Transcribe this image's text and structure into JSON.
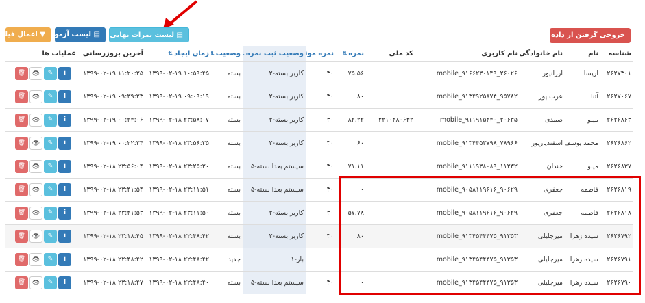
{
  "toolbar": {
    "export_label": "خروجی گرفتن از داده ها ▾",
    "final_scores_label": "▤ لیست نمرات نهایی افراد",
    "exams_label": "▤ لیست آزمون",
    "filter_label": "▼ اعمال فیلتر"
  },
  "columns": {
    "id": "شناسه",
    "first_name": "نام",
    "last_name": "نام خانوادگی",
    "username": "نام کاربری",
    "national_code": "کد ملی",
    "score": "نمره",
    "effective_score": "نمره موثر",
    "registration_status": "وضعیت ثبت نمره",
    "status": "وضعیت",
    "created": "زمان ایجاد",
    "updated": "آخرین بروزرسانی",
    "actions": "عملیات ها"
  },
  "rows": [
    {
      "id": "۲۶۲۷۳۰۱",
      "first_name": "اریسا",
      "last_name": "ارزانپور",
      "username": "mobile_۹۱۶۶۲۳۰۱۴۹_۲۶۰۲۶",
      "national_code": "",
      "score": "۷۵.۵۶",
      "effective_score": "۳۰",
      "registration_status": "کاربر بسته-۲",
      "status": "بسته",
      "created": "۱۳۹۹-۰۲-۱۹ ۱۰:۵۹:۴۵",
      "updated": "۱۳۹۹-۰۲-۱۹ ۱۱:۲۰:۲۵"
    },
    {
      "id": "۲۶۲۷۰۶۷",
      "first_name": "آتنا",
      "last_name": "عرب پور",
      "username": "mobile_۹۱۳۴۹۲۵۸۷۴_۹۵۷۸۲",
      "national_code": "",
      "score": "۸۰",
      "effective_score": "۳۰",
      "registration_status": "کاربر بسته-۲",
      "status": "بسته",
      "created": "۱۳۹۹-۰۲-۱۹ ۰۹:۰۹:۱۹",
      "updated": "۱۳۹۹-۰۲-۱۹ ۰۹:۳۹:۲۳"
    },
    {
      "id": "۲۶۲۶۸۶۳",
      "first_name": "مینو",
      "last_name": "صمدی",
      "username": "mobile_۹۱۱۹۱۵۴۴۰_۲۰۶۳۵",
      "national_code": "۲۲۱۰۴۸۰۶۴۲",
      "score": "۸۲.۲۲",
      "effective_score": "۳۰",
      "registration_status": "کاربر بسته-۲",
      "status": "بسته",
      "created": "۱۳۹۹-۰۲-۱۸ ۲۳:۵۸:۰۷",
      "updated": "۱۳۹۹-۰۲-۱۹ ۰۰:۲۴:۰۶"
    },
    {
      "id": "۲۶۲۶۸۶۲",
      "first_name": "محمد یوسف",
      "last_name": "اسفندیارپور",
      "username": "mobile_۹۱۳۴۴۵۳۷۹۸_۷۸۹۶۶",
      "national_code": "",
      "score": "۶۰",
      "effective_score": "۳۰",
      "registration_status": "کاربر بسته-۲",
      "status": "بسته",
      "created": "۱۳۹۹-۰۲-۱۸ ۲۳:۵۶:۳۵",
      "updated": "۱۳۹۹-۰۲-۱۹ ۰۰:۲۲:۲۴"
    },
    {
      "id": "۲۶۲۶۸۳۷",
      "first_name": "مینو",
      "last_name": "خندان",
      "username": "mobile_۹۱۱۱۹۳۸۰۸۹_۱۱۲۳۲",
      "national_code": "",
      "score": "۷۱.۱۱",
      "effective_score": "۳۰",
      "registration_status": "سیستم بعدا بسته-۵",
      "status": "بسته",
      "created": "۱۳۹۹-۰۲-۱۸ ۲۳:۲۵:۲۰",
      "updated": "۱۳۹۹-۰۲-۱۸ ۲۳:۵۶:۰۴"
    },
    {
      "id": "۲۶۲۶۸۱۹",
      "first_name": "فاطمه",
      "last_name": "جعفری",
      "username": "mobile_۹۰۵۸۱۱۹۶۱۶_۹۰۶۲۹",
      "national_code": "",
      "score": "۰",
      "effective_score": "۳۰",
      "registration_status": "سیستم بعدا بسته-۵",
      "status": "بسته",
      "created": "۱۳۹۹-۰۲-۱۸ ۲۳:۱۱:۵۱",
      "updated": "۱۳۹۹-۰۲-۱۸ ۲۳:۴۱:۵۴"
    },
    {
      "id": "۲۶۲۶۸۱۸",
      "first_name": "فاطمه",
      "last_name": "جعفری",
      "username": "mobile_۹۰۵۸۱۱۹۶۱۶_۹۰۶۲۹",
      "national_code": "",
      "score": "۵۷.۷۸",
      "effective_score": "۳۰",
      "registration_status": "کاربر بسته-۲",
      "status": "بسته",
      "created": "۱۳۹۹-۰۲-۱۸ ۲۳:۱۱:۵۰",
      "updated": "۱۳۹۹-۰۲-۱۸ ۲۳:۴۱:۵۳"
    },
    {
      "id": "۲۶۲۶۷۹۲",
      "first_name": "سیده زهرا",
      "last_name": "میرجلیلی",
      "username": "mobile_۹۱۳۴۵۴۴۴۷۵_۹۱۳۵۳",
      "national_code": "",
      "score": "۸۰",
      "effective_score": "۳۰",
      "registration_status": "کاربر بسته-۲",
      "status": "بسته",
      "created": "۱۳۹۹-۰۲-۱۸ ۲۲:۴۸:۴۲",
      "updated": "۱۳۹۹-۰۲-۱۸ ۲۳:۱۸:۴۵"
    },
    {
      "id": "۲۶۲۶۷۹۱",
      "first_name": "سیده زهرا",
      "last_name": "میرجلیلی",
      "username": "mobile_۹۱۳۴۵۴۴۴۷۵_۹۱۳۵۳",
      "national_code": "",
      "score": "",
      "effective_score": "",
      "registration_status": "باز-۱",
      "status": "جدید",
      "created": "۱۳۹۹-۰۲-۱۸ ۲۲:۴۸:۴۲",
      "updated": "۱۳۹۹-۰۲-۱۸ ۲۲:۴۸:۴۲"
    },
    {
      "id": "۲۶۲۶۷۹۰",
      "first_name": "سیده زهرا",
      "last_name": "میرجلیلی",
      "username": "mobile_۹۱۳۴۵۴۴۴۷۵_۹۱۳۵۳",
      "national_code": "",
      "score": "۰",
      "effective_score": "۳۰",
      "registration_status": "سیستم بعدا بسته-۵",
      "status": "بسته",
      "created": "۱۳۹۹-۰۲-۱۸ ۲۲:۴۸:۴۰",
      "updated": "۱۳۹۹-۰۲-۱۸ ۲۳:۱۸:۴۷"
    }
  ],
  "colors": {
    "export": "#d9534f",
    "final_scores": "#5bc0de",
    "exams": "#337ab7",
    "filter": "#f0ad4e",
    "highlight_box": "#e00000",
    "arrow": "#e00000"
  },
  "icons": [
    "list-icon",
    "filter-icon",
    "sort-icon",
    "info-icon",
    "edit-icon",
    "view-icon",
    "delete-icon",
    "annotation-arrow"
  ]
}
